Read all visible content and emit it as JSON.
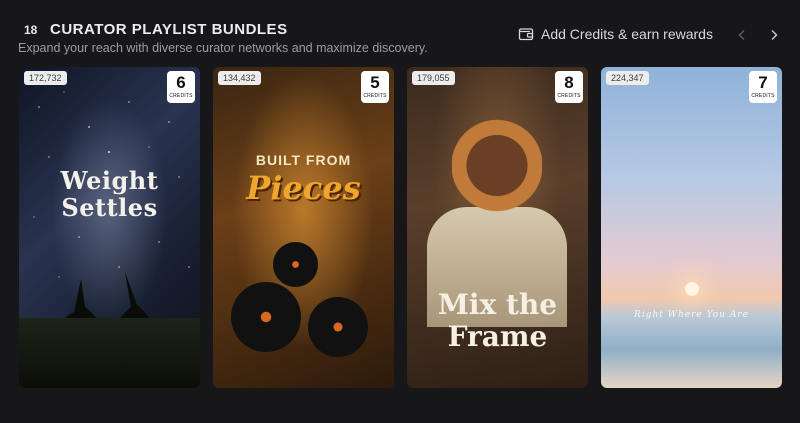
{
  "header": {
    "count": "18",
    "title": "CURATOR PLAYLIST BUNDLES",
    "subtitle": "Expand your reach with diverse curator networks and maximize discovery.",
    "add_credits_label": "Add Credits & earn rewards",
    "add_credits_icon": "wallet-icon",
    "prev_icon": "chevron-left-icon",
    "next_icon": "chevron-right-icon"
  },
  "cards": [
    {
      "reach": "172,732",
      "credits": "6",
      "credits_label": "CREDITS",
      "art_line1": "Weight",
      "art_line2": "Settles"
    },
    {
      "reach": "134,432",
      "credits": "5",
      "credits_label": "CREDITS",
      "art_line1": "BUILT FROM",
      "art_line2": "Pieces"
    },
    {
      "reach": "179,055",
      "credits": "8",
      "credits_label": "CREDITS",
      "art_line1": "Mix the",
      "art_line2": "Frame"
    },
    {
      "reach": "224,347",
      "credits": "7",
      "credits_label": "CREDITS",
      "art_line1": "Right Where You Are"
    }
  ],
  "colors": {
    "background": "#17171a",
    "text_primary": "#ececef",
    "text_secondary": "#9c9ca3"
  }
}
